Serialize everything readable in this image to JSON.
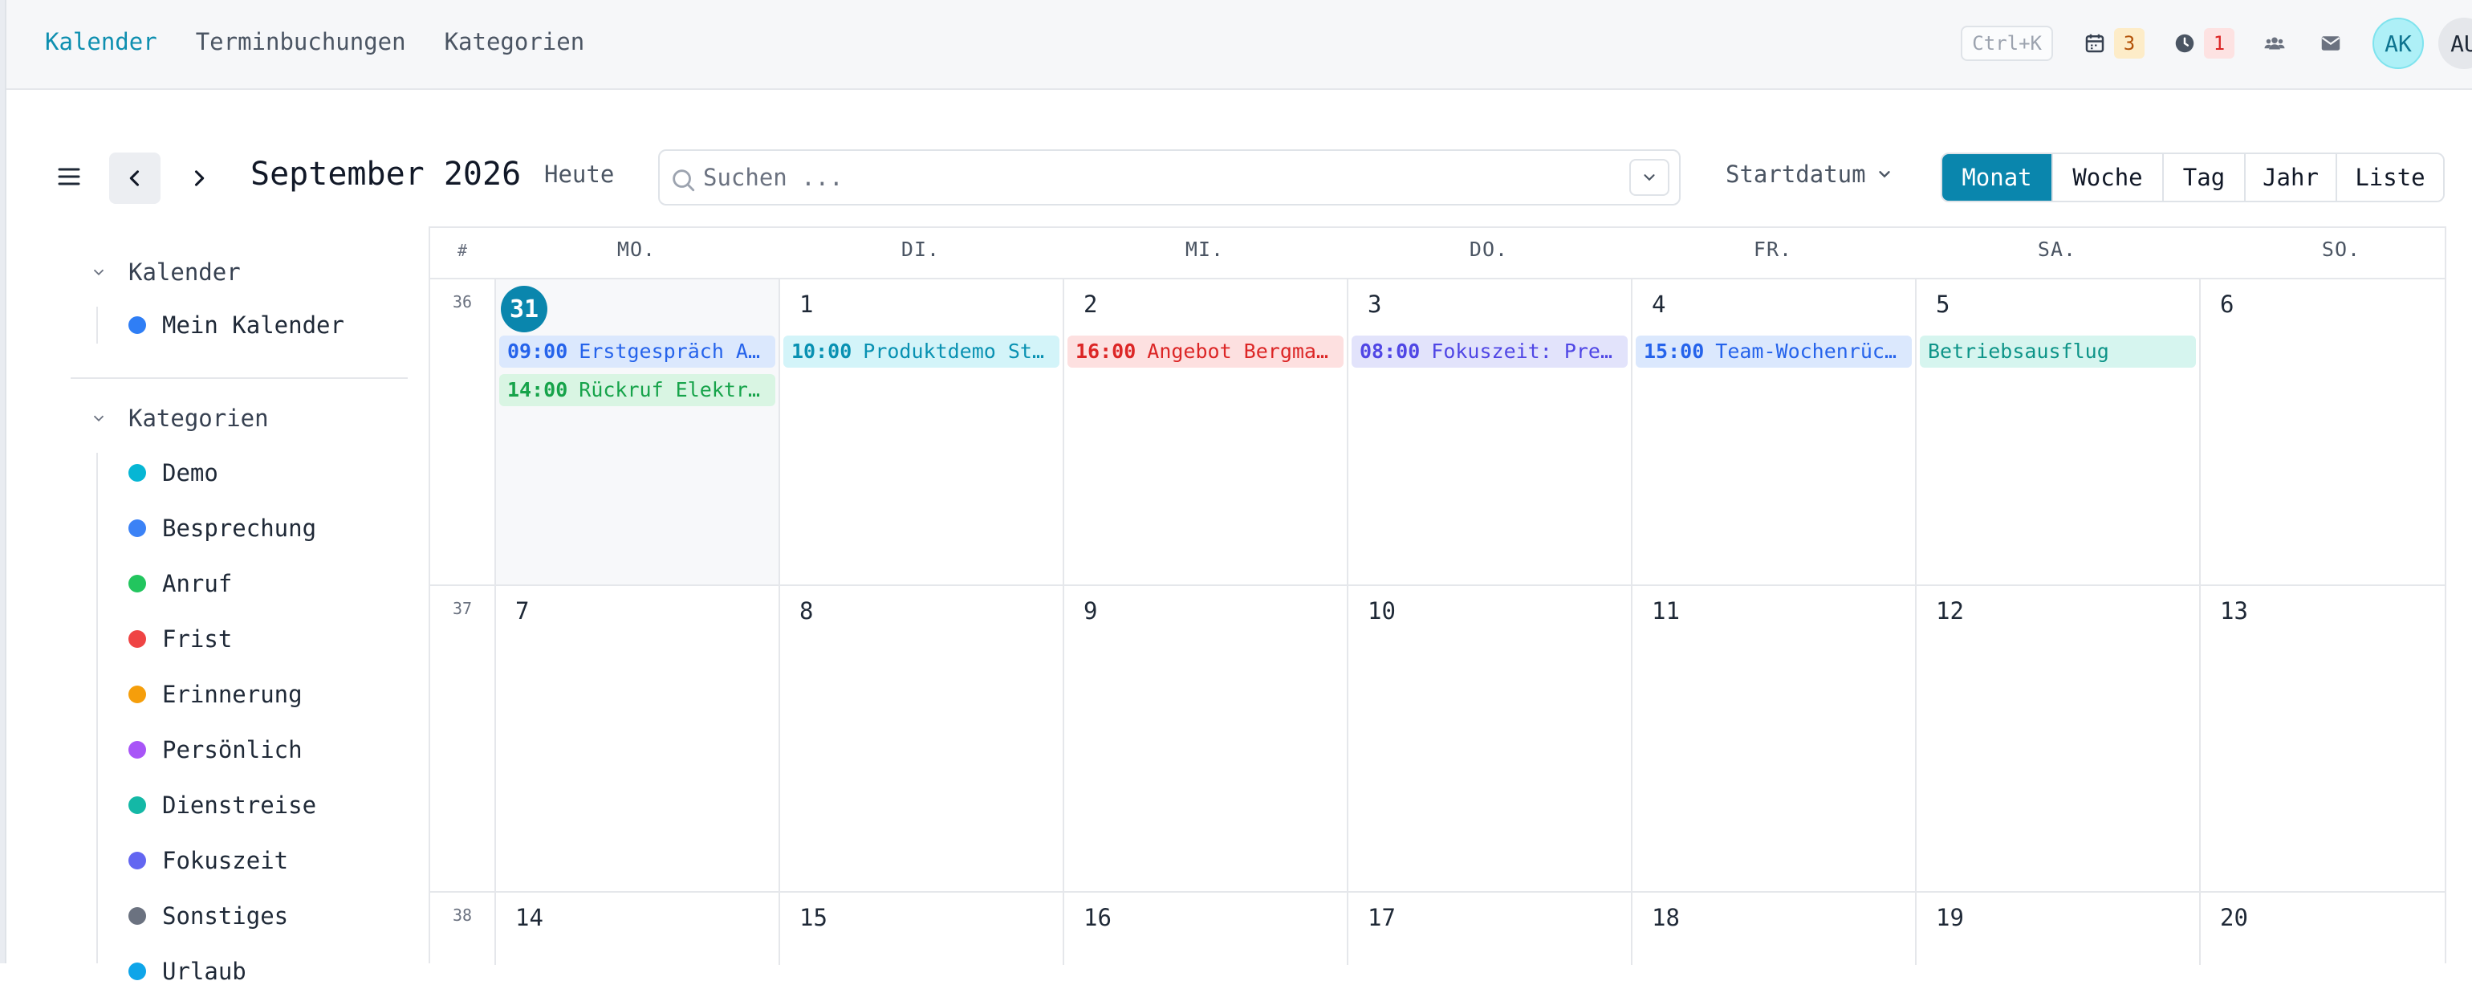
{
  "nav": {
    "items": [
      {
        "label": "Kalender",
        "active": true
      },
      {
        "label": "Terminbuchungen",
        "active": false
      },
      {
        "label": "Kategorien",
        "active": false
      }
    ]
  },
  "topbar": {
    "shortcut": "Ctrl+K",
    "calendar_badge": "3",
    "clock_badge": "1",
    "avatar_primary": "AK",
    "avatar_secondary": "AU"
  },
  "toolbar": {
    "title": "September 2026",
    "today_label": "Heute",
    "search_placeholder": "Suchen ...",
    "sort_label": "Startdatum",
    "views": [
      {
        "label": "Monat",
        "active": true
      },
      {
        "label": "Woche",
        "active": false
      },
      {
        "label": "Tag",
        "active": false
      },
      {
        "label": "Jahr",
        "active": false
      },
      {
        "label": "Liste",
        "active": false
      }
    ]
  },
  "sidebar": {
    "calendars_title": "Kalender",
    "calendars": [
      {
        "label": "Mein Kalender",
        "color": "#2f7ef5"
      }
    ],
    "categories_title": "Kategorien",
    "categories": [
      {
        "label": "Demo",
        "color": "#06b6d4"
      },
      {
        "label": "Besprechung",
        "color": "#3b82f6"
      },
      {
        "label": "Anruf",
        "color": "#22c55e"
      },
      {
        "label": "Frist",
        "color": "#ef4444"
      },
      {
        "label": "Erinnerung",
        "color": "#f59e0b"
      },
      {
        "label": "Persönlich",
        "color": "#a855f7"
      },
      {
        "label": "Dienstreise",
        "color": "#14b8a6"
      },
      {
        "label": "Fokuszeit",
        "color": "#6366f1"
      },
      {
        "label": "Sonstiges",
        "color": "#6b7280"
      },
      {
        "label": "Urlaub",
        "color": "#0ea5e9"
      }
    ]
  },
  "calendar": {
    "week_header": "#",
    "day_names": [
      "MO.",
      "DI.",
      "MI.",
      "DO.",
      "FR.",
      "SA.",
      "SO."
    ],
    "weeks": [
      {
        "number": "36",
        "days": [
          {
            "day": "31",
            "today": true,
            "events": [
              {
                "time": "09:00",
                "title": "Erstgespräch A…",
                "category": "Besprechung"
              },
              {
                "time": "14:00",
                "title": "Rückruf Elektr…",
                "category": "Anruf"
              }
            ]
          },
          {
            "day": "1",
            "events": [
              {
                "time": "10:00",
                "title": "Produktdemo St…",
                "category": "Demo"
              }
            ]
          },
          {
            "day": "2",
            "events": [
              {
                "time": "16:00",
                "title": "Angebot Bergma…",
                "category": "Frist"
              }
            ]
          },
          {
            "day": "3",
            "events": [
              {
                "time": "08:00",
                "title": "Fokuszeit: Pre…",
                "category": "Fokuszeit"
              }
            ]
          },
          {
            "day": "4",
            "events": [
              {
                "time": "15:00",
                "title": "Team-Wochenrüc…",
                "category": "Besprechung"
              }
            ]
          },
          {
            "day": "5",
            "events": [
              {
                "time": "",
                "title": "Betriebsausflug",
                "category": "Dienstreise"
              }
            ]
          },
          {
            "day": "6",
            "events": []
          }
        ]
      },
      {
        "number": "37",
        "days": [
          {
            "day": "7",
            "events": []
          },
          {
            "day": "8",
            "events": []
          },
          {
            "day": "9",
            "events": []
          },
          {
            "day": "10",
            "events": []
          },
          {
            "day": "11",
            "events": []
          },
          {
            "day": "12",
            "events": []
          },
          {
            "day": "13",
            "events": []
          }
        ]
      },
      {
        "number": "38",
        "days": [
          {
            "day": "14",
            "events": []
          },
          {
            "day": "15",
            "events": []
          },
          {
            "day": "16",
            "events": []
          },
          {
            "day": "17",
            "events": []
          },
          {
            "day": "18",
            "events": []
          },
          {
            "day": "19",
            "events": []
          },
          {
            "day": "20",
            "events": []
          }
        ]
      }
    ]
  },
  "event_colors": {
    "Besprechung": {
      "bg": "#dbe8fd",
      "fg": "#2563eb"
    },
    "Anruf": {
      "bg": "#d9f5e3",
      "fg": "#16a34a"
    },
    "Demo": {
      "bg": "#d3f4f9",
      "fg": "#0891b2"
    },
    "Frist": {
      "bg": "#fde0e0",
      "fg": "#dc2626"
    },
    "Fokuszeit": {
      "bg": "#e2e3fb",
      "fg": "#4f46e5"
    },
    "Dienstreise": {
      "bg": "#d6f5ef",
      "fg": "#0d9488"
    }
  }
}
